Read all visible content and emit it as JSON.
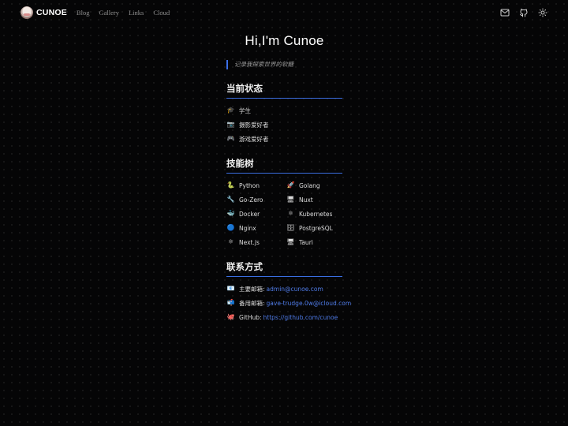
{
  "nav": {
    "brand": "CUNOE",
    "links": [
      "Blog",
      "Gallery",
      "Links",
      "Cloud"
    ],
    "icons": [
      "mail-icon",
      "github-icon",
      "theme-toggle-icon"
    ]
  },
  "hero": {
    "title": "Hi,I'm Cunoe",
    "quote": "记录我探索世界的软糖"
  },
  "status": {
    "title": "当前状态",
    "items": [
      {
        "icon": "graduation-cap-icon",
        "glyph": "🎓",
        "label": "学生"
      },
      {
        "icon": "camera-icon",
        "glyph": "📷",
        "label": "摄影爱好者"
      },
      {
        "icon": "gamepad-icon",
        "glyph": "🎮",
        "label": "游戏爱好者"
      }
    ]
  },
  "skills": {
    "title": "技能树",
    "items": [
      {
        "icon": "python-icon",
        "glyph": "🐍",
        "label": "Python"
      },
      {
        "icon": "rocket-icon",
        "glyph": "🚀",
        "label": "Golang"
      },
      {
        "icon": "wrench-icon",
        "glyph": "🔧",
        "label": "Go-Zero"
      },
      {
        "icon": "monitor-icon",
        "glyph": "🖥",
        "label": "Nuxt"
      },
      {
        "icon": "whale-icon",
        "glyph": "🐳",
        "label": "Docker"
      },
      {
        "icon": "atom-icon",
        "glyph": "⚛",
        "label": "Kubernetes"
      },
      {
        "icon": "blue-circle-icon",
        "glyph": "🔵",
        "label": "Nginx"
      },
      {
        "icon": "database-icon",
        "glyph": "🗄",
        "label": "PostgreSQL"
      },
      {
        "icon": "atom-icon",
        "glyph": "⚛",
        "label": "Next.js"
      },
      {
        "icon": "monitor-icon",
        "glyph": "🖥",
        "label": "Tauri"
      }
    ]
  },
  "contact": {
    "title": "联系方式",
    "items": [
      {
        "icon": "email-icon",
        "glyph": "📧",
        "label": "主要邮箱:",
        "value": "admin@cunoe.com"
      },
      {
        "icon": "mailbox-icon",
        "glyph": "📬",
        "label": "备用邮箱:",
        "value": "gave-trudge.0w@icloud.com"
      },
      {
        "icon": "octopus-icon",
        "glyph": "🐙",
        "label": "GitHub:",
        "value": "https://github.com/cunoe"
      }
    ]
  },
  "colors": {
    "accent": "#3b6fe8",
    "link": "#4e7ae6",
    "background": "#050506"
  }
}
